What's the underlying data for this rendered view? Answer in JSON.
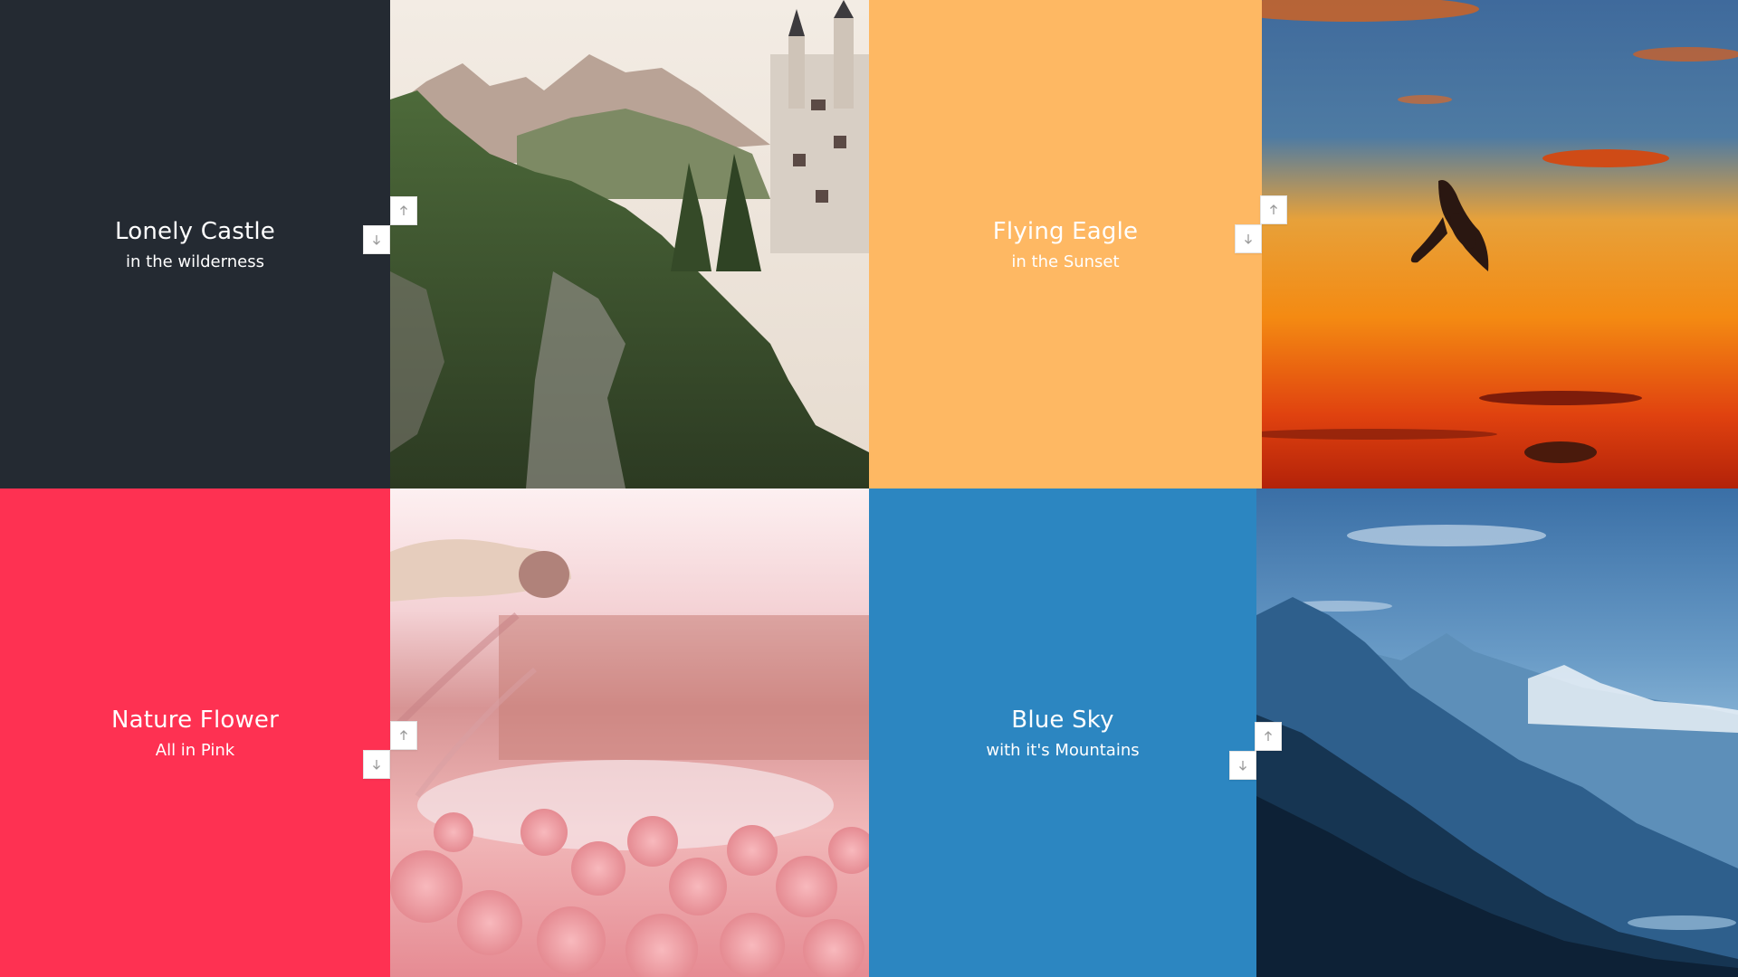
{
  "tiles": [
    {
      "title": "Lonely Castle",
      "subtitle": "in the wilderness",
      "color": "#242a32",
      "image": "castle-photo"
    },
    {
      "title": "Flying Eagle",
      "subtitle": "in the Sunset",
      "color": "#feb863",
      "image": "eagle-sunset-photo"
    },
    {
      "title": "Nature Flower",
      "subtitle": "All in Pink",
      "color": "#fe3152",
      "image": "pink-flowers-photo"
    },
    {
      "title": "Blue Sky",
      "subtitle": "with it's Mountains",
      "color": "#2c86c1",
      "image": "blue-mountains-photo"
    }
  ],
  "icons": {
    "up": "arrow-up-icon",
    "down": "arrow-down-icon"
  }
}
